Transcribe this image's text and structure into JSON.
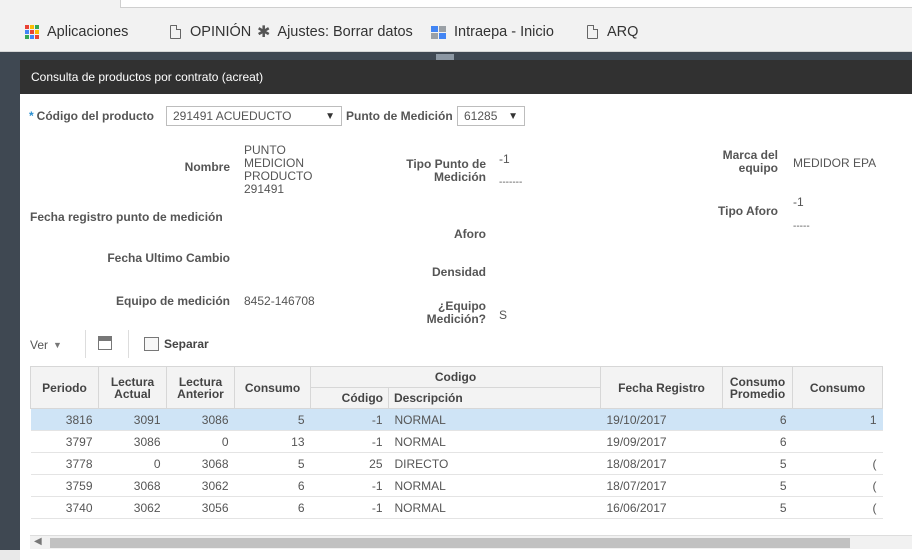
{
  "bookmarks": [
    {
      "label": "Aplicaciones",
      "icon": "apps-grid-icon"
    },
    {
      "label": "OPINIÓN",
      "icon": "document-icon"
    },
    {
      "label": "Ajustes: Borrar datos",
      "icon": "gear-icon"
    },
    {
      "label": "Intraepa - Inicio",
      "icon": "intraepa-icon"
    },
    {
      "label": "ARQ",
      "icon": "document-icon"
    }
  ],
  "dialog": {
    "title": "Consulta de productos por contrato (acreat)"
  },
  "filters": {
    "codigo_label": "Código del producto",
    "codigo_value": "291491 ACUEDUCTO",
    "punto_label": "Punto de Medición",
    "punto_value": "61285"
  },
  "details": {
    "nombre_label": "Nombre",
    "nombre_value": "PUNTO MEDICION PRODUCTO 291491",
    "fecha_registro_label": "Fecha registro punto de medición",
    "fecha_ultimo_label": "Fecha Ultimo Cambio",
    "equipo_label": "Equipo de medición",
    "equipo_value": "8452-146708",
    "tipo_punto_label": "Tipo Punto de Medición",
    "tipo_punto_value": "-1",
    "tipo_punto_desc": "-------",
    "aforo_label": "Aforo",
    "densidad_label": "Densidad",
    "equipo_medicion_q_label": "¿Equipo Medición?",
    "equipo_medicion_q_value": "S",
    "marca_label": "Marca del equipo",
    "marca_value": "MEDIDOR EPA",
    "tipo_aforo_label": "Tipo Aforo",
    "tipo_aforo_value": "-1",
    "tipo_aforo_desc": "-----"
  },
  "toolbar": {
    "ver_label": "Ver",
    "separar_label": "Separar"
  },
  "table": {
    "headers": {
      "periodo": "Periodo",
      "lectura_actual": "Lectura Actual",
      "lectura_anterior": "Lectura Anterior",
      "consumo": "Consumo",
      "codigo_group": "Codigo",
      "codigo": "Código",
      "descripcion": "Descripción",
      "fecha_registro": "Fecha Registro",
      "consumo_promedio": "Consumo Promedio",
      "consumo2": "Consumo"
    },
    "rows": [
      {
        "periodo": "3816",
        "actual": "3091",
        "anterior": "3086",
        "consumo": "5",
        "codigo": "-1",
        "descripcion": "NORMAL",
        "fecha": "19/10/2017",
        "promedio": "6",
        "consumo2": "1"
      },
      {
        "periodo": "3797",
        "actual": "3086",
        "anterior": "0",
        "consumo": "13",
        "codigo": "-1",
        "descripcion": "NORMAL",
        "fecha": "19/09/2017",
        "promedio": "6",
        "consumo2": ""
      },
      {
        "periodo": "3778",
        "actual": "0",
        "anterior": "3068",
        "consumo": "5",
        "codigo": "25",
        "descripcion": "DIRECTO",
        "fecha": "18/08/2017",
        "promedio": "5",
        "consumo2": "("
      },
      {
        "periodo": "3759",
        "actual": "3068",
        "anterior": "3062",
        "consumo": "6",
        "codigo": "-1",
        "descripcion": "NORMAL",
        "fecha": "18/07/2017",
        "promedio": "5",
        "consumo2": "("
      },
      {
        "periodo": "3740",
        "actual": "3062",
        "anterior": "3056",
        "consumo": "6",
        "codigo": "-1",
        "descripcion": "NORMAL",
        "fecha": "16/06/2017",
        "promedio": "5",
        "consumo2": "("
      }
    ]
  }
}
